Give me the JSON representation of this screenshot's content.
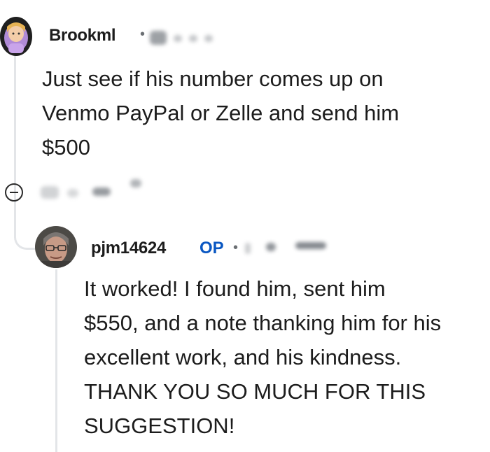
{
  "comment1": {
    "username": "Brookml",
    "body": "Just see if his number comes up on\nVenmo PayPal or Zelle and send him\n$500"
  },
  "reply": {
    "username": "pjm14624",
    "op_badge": "OP",
    "body": "It worked! I found him, sent him\n$550, and a note thanking him for his\nexcellent work, and his kindness.\nTHANK YOU SO MUCH FOR THIS\nSUGGESTION!"
  },
  "icons": {
    "collapse": "collapse-thread-icon"
  },
  "colors": {
    "op_badge": "#0a57c2",
    "text": "#1c1c1c",
    "thread_line": "#e3e5e8"
  }
}
